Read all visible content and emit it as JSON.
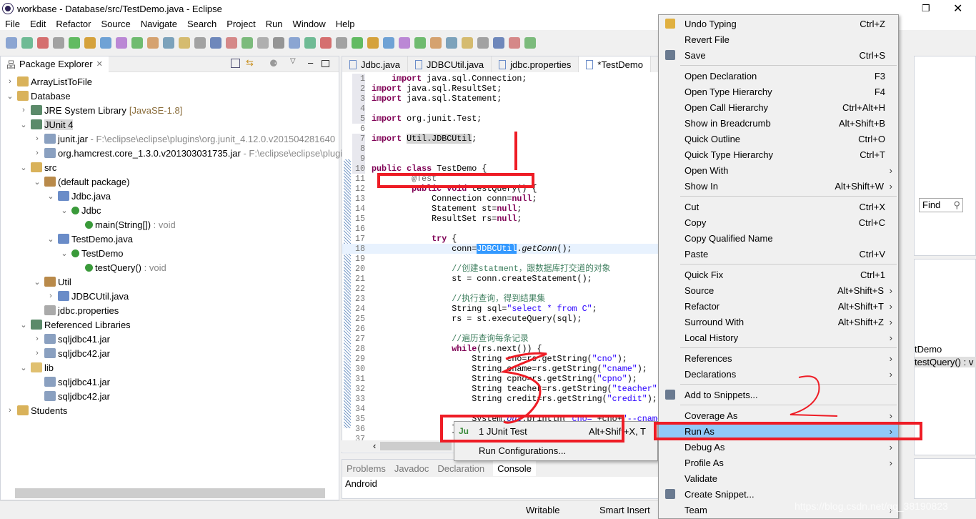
{
  "window": {
    "title": "workbase - Database/src/TestDemo.java - Eclipse",
    "quick_access": "ccess"
  },
  "menubar": [
    "File",
    "Edit",
    "Refactor",
    "Source",
    "Navigate",
    "Search",
    "Project",
    "Run",
    "Window",
    "Help"
  ],
  "package_explorer": {
    "title": "Package Explorer",
    "tree": [
      {
        "level": 0,
        "exp": false,
        "label": "ArrayListToFile",
        "icon": "project-icon"
      },
      {
        "level": 0,
        "exp": true,
        "label": "Database",
        "icon": "project-icon"
      },
      {
        "level": 1,
        "exp": false,
        "label": "JRE System Library",
        "suffix": "[JavaSE-1.8]",
        "icon": "library-icon"
      },
      {
        "level": 1,
        "exp": true,
        "label": "JUnit 4",
        "icon": "library-icon",
        "selected": true
      },
      {
        "level": 2,
        "exp": false,
        "label": "junit.jar",
        "dim": " - F:\\eclipse\\eclipse\\plugins\\org.junit_4.12.0.v201504281640",
        "icon": "jar-icon"
      },
      {
        "level": 2,
        "exp": false,
        "label": "org.hamcrest.core_1.3.0.v201303031735.jar",
        "dim": " - F:\\eclipse\\eclipse\\plugins",
        "icon": "jar-icon"
      },
      {
        "level": 1,
        "exp": true,
        "label": "src",
        "icon": "source-folder-icon"
      },
      {
        "level": 2,
        "exp": true,
        "label": "(default package)",
        "icon": "package-icon"
      },
      {
        "level": 3,
        "exp": true,
        "label": "Jdbc.java",
        "icon": "java-file-icon"
      },
      {
        "level": 4,
        "exp": true,
        "label": "Jdbc",
        "icon": "class-icon"
      },
      {
        "level": 5,
        "label": "main(String[])",
        "dim": " : void",
        "icon": "method-icon"
      },
      {
        "level": 3,
        "exp": true,
        "label": "TestDemo.java",
        "icon": "java-file-icon"
      },
      {
        "level": 4,
        "exp": true,
        "label": "TestDemo",
        "icon": "class-icon"
      },
      {
        "level": 5,
        "label": "testQuery()",
        "dim": " : void",
        "icon": "method-icon"
      },
      {
        "level": 2,
        "exp": true,
        "label": "Util",
        "icon": "package-icon"
      },
      {
        "level": 3,
        "exp": false,
        "label": "JDBCUtil.java",
        "icon": "java-file-icon"
      },
      {
        "level": 2,
        "label": "jdbc.properties",
        "icon": "file-icon"
      },
      {
        "level": 1,
        "exp": true,
        "label": "Referenced Libraries",
        "icon": "library-icon"
      },
      {
        "level": 2,
        "exp": false,
        "label": "sqljdbc41.jar",
        "icon": "jar-icon"
      },
      {
        "level": 2,
        "exp": false,
        "label": "sqljdbc42.jar",
        "icon": "jar-icon"
      },
      {
        "level": 1,
        "exp": true,
        "label": "lib",
        "icon": "folder-icon"
      },
      {
        "level": 2,
        "label": "sqljdbc41.jar",
        "icon": "jar-icon"
      },
      {
        "level": 2,
        "label": "sqljdbc42.jar",
        "icon": "jar-icon"
      },
      {
        "level": 0,
        "exp": false,
        "label": "Students",
        "icon": "project-icon"
      }
    ]
  },
  "editor": {
    "tabs": [
      {
        "label": "Jdbc.java"
      },
      {
        "label": "JDBCUtil.java"
      },
      {
        "label": "jdbc.properties"
      },
      {
        "label": "*TestDemo",
        "active": true
      }
    ],
    "lines": [
      [
        [
          "",
          "    "
        ],
        [
          "kw",
          "import"
        ],
        [
          "",
          " java.sql.Connection;"
        ]
      ],
      [
        [
          "kw",
          "import"
        ],
        [
          "",
          " java.sql.ResultSet;"
        ]
      ],
      [
        [
          "kw",
          "import"
        ],
        [
          "",
          " java.sql.Statement;"
        ]
      ],
      [],
      [
        [
          "kw",
          "import"
        ],
        [
          "",
          " org.junit.Test;"
        ]
      ],
      [],
      [
        [
          "kw",
          "import"
        ],
        [
          "",
          " "
        ],
        [
          "mark",
          "Util.JDBCUtil"
        ],
        [
          "",
          ";"
        ]
      ],
      [],
      [],
      [
        [
          "kw",
          "public"
        ],
        [
          "",
          " "
        ],
        [
          "kw",
          "class"
        ],
        [
          "",
          " TestDemo {"
        ]
      ],
      [
        [
          "",
          "        "
        ],
        [
          "an",
          "@Test"
        ]
      ],
      [
        [
          "",
          "        "
        ],
        [
          "kw",
          "public"
        ],
        [
          "",
          " "
        ],
        [
          "kw",
          "void"
        ],
        [
          "",
          " testQuery() {"
        ]
      ],
      [
        [
          "",
          "            Connection conn="
        ],
        [
          "kw",
          "null"
        ],
        [
          "",
          ";"
        ]
      ],
      [
        [
          "",
          "            Statement st="
        ],
        [
          "kw",
          "null"
        ],
        [
          "",
          ";"
        ]
      ],
      [
        [
          "",
          "            ResultSet rs="
        ],
        [
          "kw",
          "null"
        ],
        [
          "",
          ";"
        ]
      ],
      [],
      [
        [
          "",
          "            "
        ],
        [
          "kw",
          "try"
        ],
        [
          "",
          " {"
        ]
      ],
      [
        [
          "",
          "                conn="
        ],
        [
          "sel",
          "JDBCUtil"
        ],
        [
          "",
          "."
        ],
        [
          "fldi",
          "getConn"
        ],
        [
          "",
          "();"
        ]
      ],
      [],
      [
        [
          "",
          "                "
        ],
        [
          "cm",
          "//创建statment，跟数据库打交道的对象"
        ]
      ],
      [
        [
          "",
          "                st = conn.createStatement();"
        ]
      ],
      [],
      [
        [
          "",
          "                "
        ],
        [
          "cm",
          "//执行查询，得到结果集"
        ]
      ],
      [
        [
          "",
          "                String sql="
        ],
        [
          "str",
          "\"select * from C\""
        ],
        [
          "",
          ";"
        ]
      ],
      [
        [
          "",
          "                rs = st.executeQuery(sql);"
        ]
      ],
      [],
      [
        [
          "",
          "                "
        ],
        [
          "cm",
          "//遍历查询每条记录"
        ]
      ],
      [
        [
          "",
          "                "
        ],
        [
          "kw",
          "while"
        ],
        [
          "",
          "(rs.next()) {"
        ]
      ],
      [
        [
          "",
          "                    String cno=rs.getString("
        ],
        [
          "str",
          "\"cno\""
        ],
        [
          "",
          ");"
        ]
      ],
      [
        [
          "",
          "                    String cname=rs.getString("
        ],
        [
          "str",
          "\"cname\""
        ],
        [
          "",
          ");"
        ]
      ],
      [
        [
          "",
          "                    String cpno=rs.getString("
        ],
        [
          "str",
          "\"cpno\""
        ],
        [
          "",
          ");"
        ]
      ],
      [
        [
          "",
          "                    String teacher=rs.getString("
        ],
        [
          "str",
          "\"teacher\""
        ],
        [
          "",
          ");"
        ]
      ],
      [
        [
          "",
          "                    String credit=rs.getString("
        ],
        [
          "str",
          "\"credit\""
        ],
        [
          "",
          ");"
        ]
      ],
      [],
      [
        [
          "",
          "                    System."
        ],
        [
          "fld",
          "out"
        ],
        [
          "",
          ".println("
        ],
        [
          "str",
          "\"cno=\""
        ],
        [
          "",
          "+cno+"
        ],
        [
          "str",
          "\"--cname"
        ]
      ],
      [
        [
          "",
          "                }"
        ]
      ],
      []
    ]
  },
  "bottom_panel": {
    "tabs": [
      "Problems",
      "Javadoc",
      "Declaration",
      "Console"
    ],
    "active": "Console",
    "content": "Android"
  },
  "status": {
    "writable": "Writable",
    "insert_mode": "Smart Insert"
  },
  "context_menu": [
    {
      "label": "Undo Typing",
      "shortcut": "Ctrl+Z",
      "icon": "undo-icon"
    },
    {
      "label": "Revert File"
    },
    {
      "label": "Save",
      "shortcut": "Ctrl+S",
      "icon": "save-icon"
    },
    {
      "sep": true
    },
    {
      "label": "Open Declaration",
      "shortcut": "F3"
    },
    {
      "label": "Open Type Hierarchy",
      "shortcut": "F4"
    },
    {
      "label": "Open Call Hierarchy",
      "shortcut": "Ctrl+Alt+H"
    },
    {
      "label": "Show in Breadcrumb",
      "shortcut": "Alt+Shift+B"
    },
    {
      "label": "Quick Outline",
      "shortcut": "Ctrl+O"
    },
    {
      "label": "Quick Type Hierarchy",
      "shortcut": "Ctrl+T"
    },
    {
      "label": "Open With",
      "sub": true
    },
    {
      "label": "Show In",
      "shortcut": "Alt+Shift+W",
      "sub": true
    },
    {
      "sep": true
    },
    {
      "label": "Cut",
      "shortcut": "Ctrl+X"
    },
    {
      "label": "Copy",
      "shortcut": "Ctrl+C"
    },
    {
      "label": "Copy Qualified Name"
    },
    {
      "label": "Paste",
      "shortcut": "Ctrl+V"
    },
    {
      "sep": true
    },
    {
      "label": "Quick Fix",
      "shortcut": "Ctrl+1"
    },
    {
      "label": "Source",
      "shortcut": "Alt+Shift+S",
      "sub": true
    },
    {
      "label": "Refactor",
      "shortcut": "Alt+Shift+T",
      "sub": true
    },
    {
      "label": "Surround With",
      "shortcut": "Alt+Shift+Z",
      "sub": true
    },
    {
      "label": "Local History",
      "sub": true
    },
    {
      "sep": true
    },
    {
      "label": "References",
      "sub": true
    },
    {
      "label": "Declarations",
      "sub": true
    },
    {
      "sep": true
    },
    {
      "label": "Add to Snippets...",
      "icon": "snippet-icon"
    },
    {
      "sep": true
    },
    {
      "label": "Coverage As",
      "sub": true
    },
    {
      "label": "Run As",
      "sub": true,
      "highlighted": true
    },
    {
      "label": "Debug As",
      "sub": true
    },
    {
      "label": "Profile As",
      "sub": true
    },
    {
      "label": "Validate"
    },
    {
      "label": "Create Snippet...",
      "icon": "snippet-icon"
    },
    {
      "label": "Team",
      "sub": true
    }
  ],
  "run_as_submenu": [
    {
      "label": "1 JUnit Test",
      "shortcut": "Alt+Shift+X, T",
      "icon": "junit-icon",
      "icon_text": "Ju"
    },
    {
      "label": "Run Configurations..."
    }
  ],
  "right_panels": {
    "find_label": "Find",
    "outline_class": "tDemo",
    "outline_method": "testQuery() : v"
  },
  "watermark": "https://blog.csdn.net/qq_38190823",
  "colors": {
    "menu_highlight": "#91c9f7",
    "annotation_red": "#ee1c25",
    "selection": "#3399ff"
  }
}
